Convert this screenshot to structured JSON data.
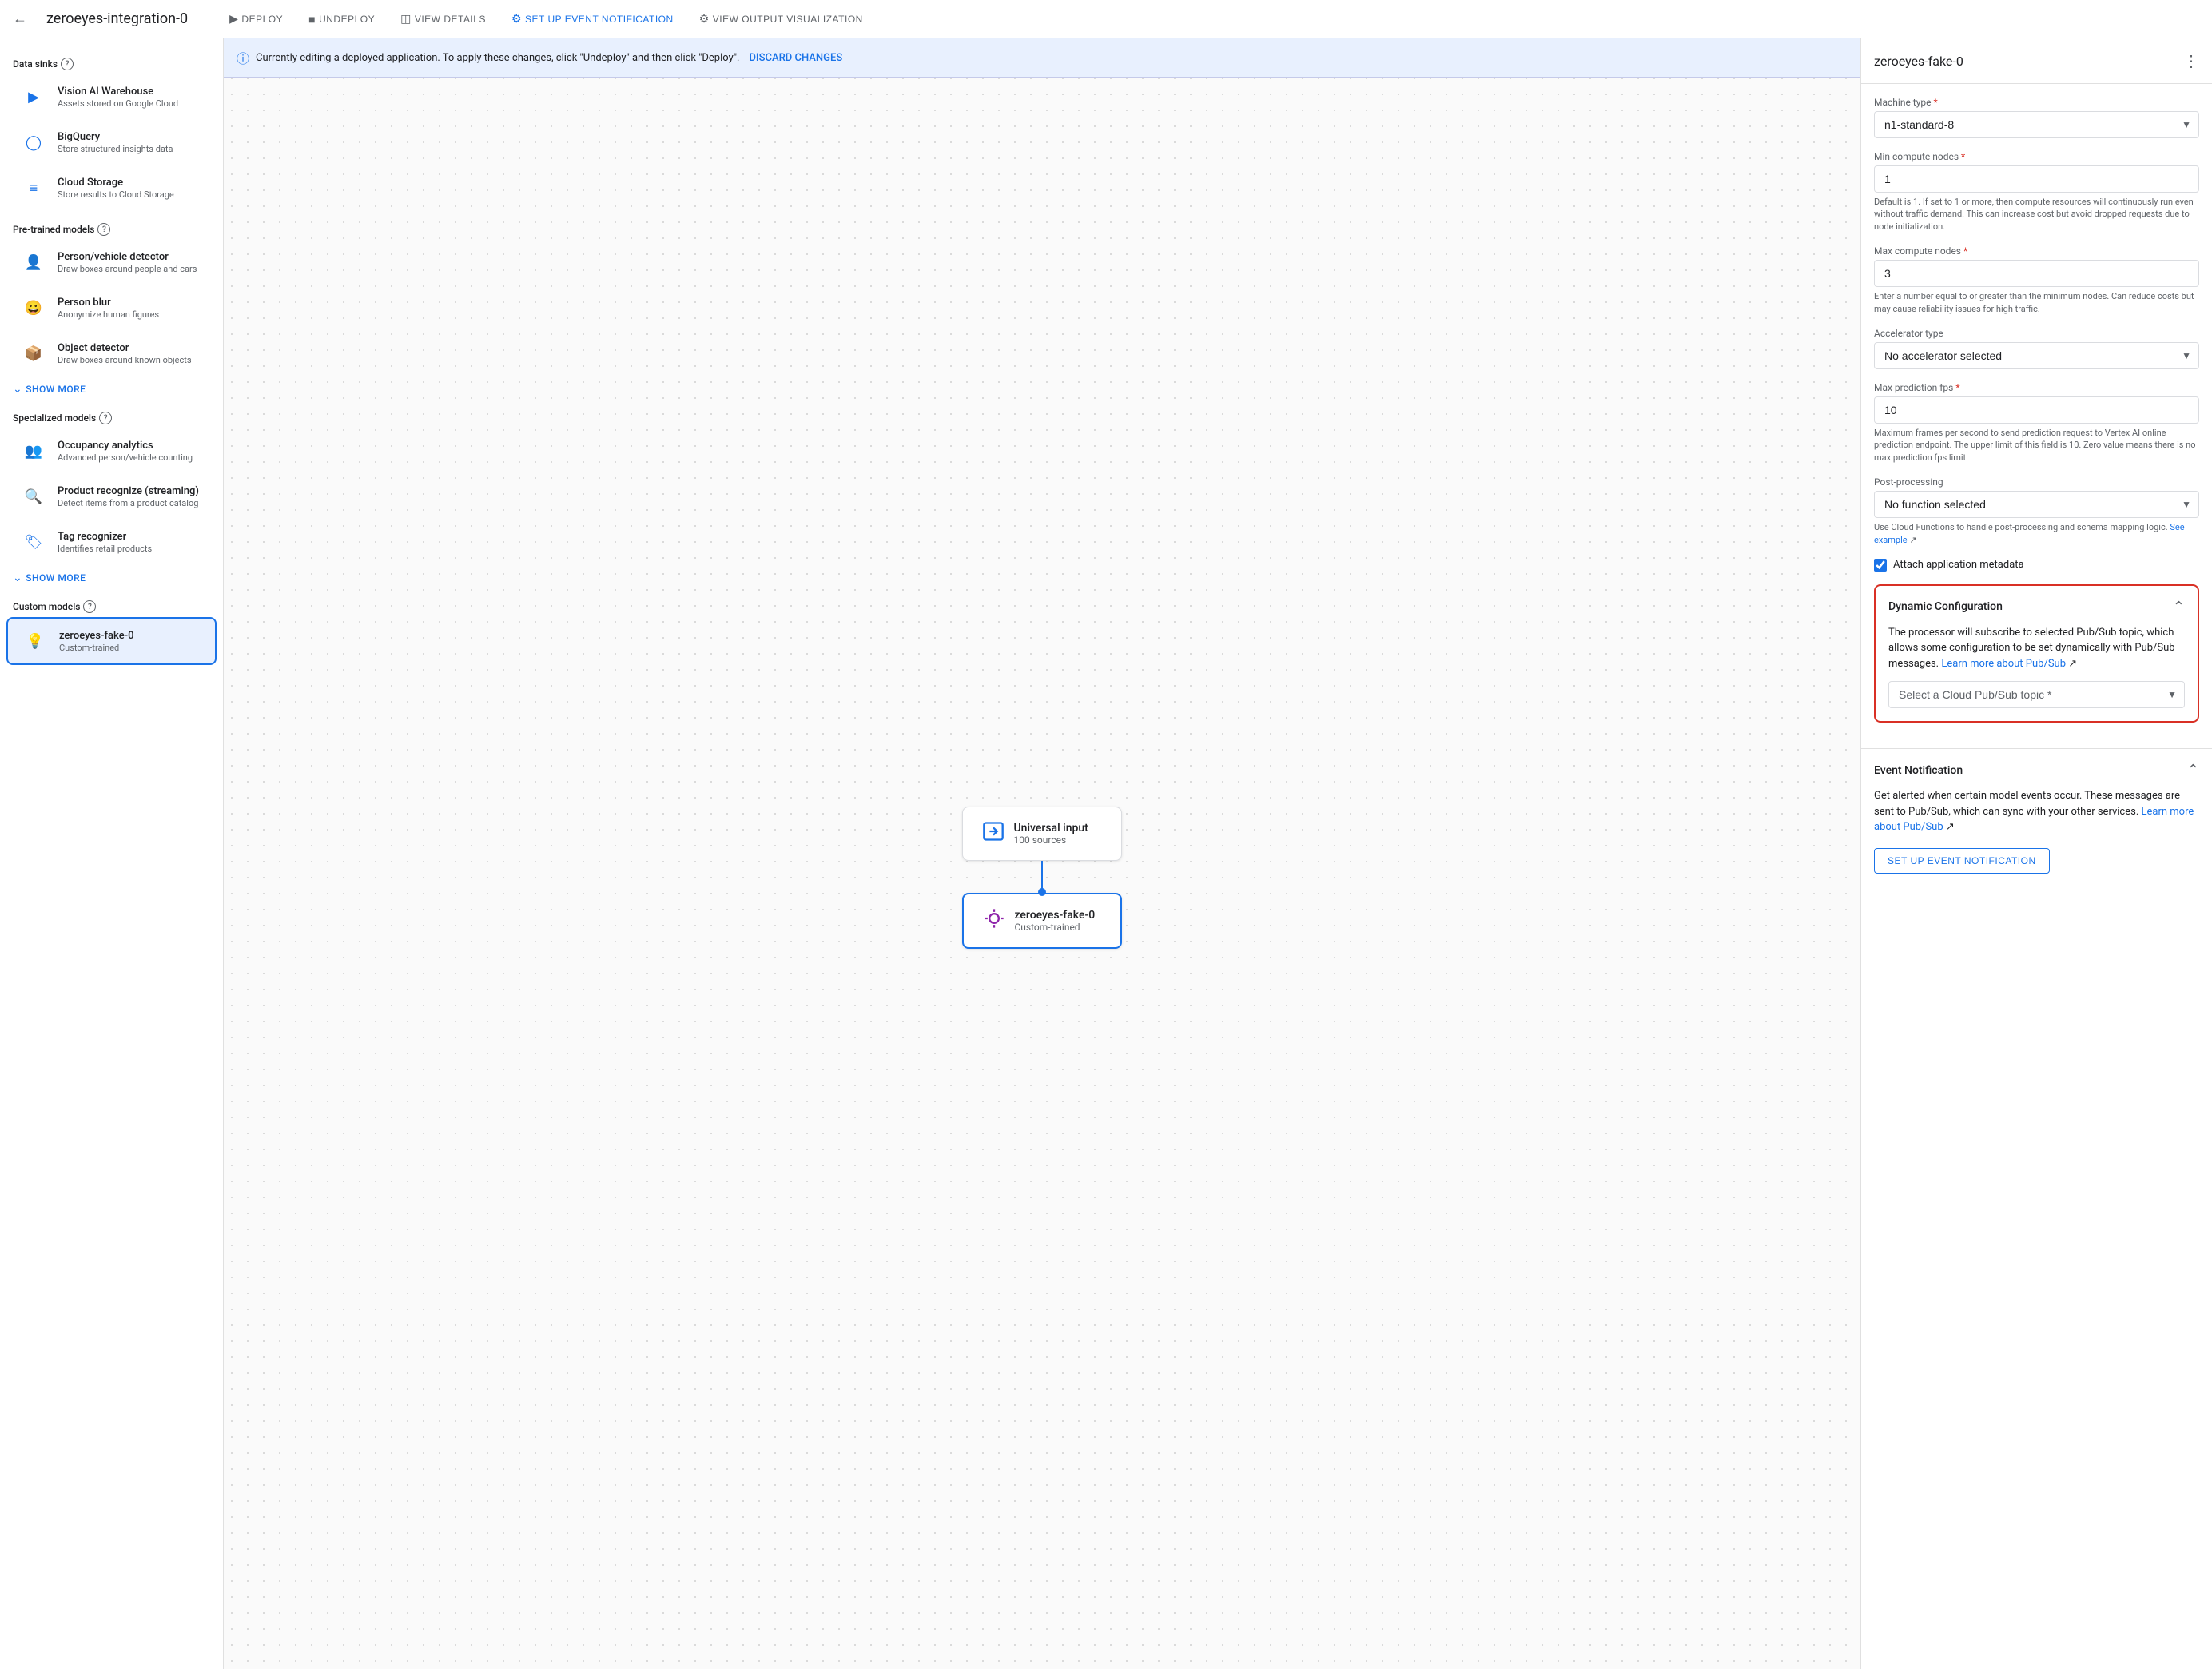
{
  "header": {
    "app_title": "zeroeyes-integration-0",
    "nav_items": [
      {
        "label": "DEPLOY",
        "icon": "▶",
        "active": false
      },
      {
        "label": "UNDEPLOY",
        "icon": "■",
        "active": false
      },
      {
        "label": "VIEW DETAILS",
        "icon": "⊞",
        "active": false
      },
      {
        "label": "SET UP EVENT NOTIFICATION",
        "icon": "⚙",
        "active": true
      },
      {
        "label": "VIEW OUTPUT VISUALIZATION",
        "icon": "⚙",
        "active": false
      }
    ]
  },
  "sidebar": {
    "data_sinks_title": "Data sinks",
    "pre_trained_title": "Pre-trained models",
    "specialized_title": "Specialized models",
    "custom_title": "Custom models",
    "show_more_label": "SHOW MORE",
    "data_sinks": [
      {
        "title": "Vision AI Warehouse",
        "desc": "Assets stored on Google Cloud",
        "icon": "▶",
        "color": "blue"
      },
      {
        "title": "BigQuery",
        "desc": "Store structured insights data",
        "icon": "◎",
        "color": "blue"
      },
      {
        "title": "Cloud Storage",
        "desc": "Store results to Cloud Storage",
        "icon": "≡",
        "color": "blue"
      }
    ],
    "pre_trained": [
      {
        "title": "Person/vehicle detector",
        "desc": "Draw boxes around people and cars",
        "icon": "👤",
        "color": "teal"
      },
      {
        "title": "Person blur",
        "desc": "Anonymize human figures",
        "icon": "😊",
        "color": "teal"
      },
      {
        "title": "Object detector",
        "desc": "Draw boxes around known objects",
        "icon": "📦",
        "color": "teal"
      }
    ],
    "specialized": [
      {
        "title": "Occupancy analytics",
        "desc": "Advanced person/vehicle counting",
        "icon": "👥",
        "color": "teal"
      },
      {
        "title": "Product recognize (streaming)",
        "desc": "Detect items from a product catalog",
        "icon": "🔍",
        "color": "teal"
      },
      {
        "title": "Tag recognizer",
        "desc": "Identifies retail products",
        "icon": "🏷",
        "color": "teal"
      }
    ],
    "custom": [
      {
        "title": "zeroeyes-fake-0",
        "desc": "Custom-trained",
        "icon": "💡",
        "color": "purple",
        "selected": true
      }
    ]
  },
  "canvas": {
    "banner_text": "Currently editing a deployed application. To apply these changes, click \"Undeploy\" and then click \"Deploy\".",
    "discard_label": "DISCARD CHANGES",
    "universal_input_title": "Universal input",
    "universal_input_subtitle": "100 sources",
    "node_title": "zeroeyes-fake-0",
    "node_subtitle": "Custom-trained"
  },
  "right_panel": {
    "title": "zeroeyes-fake-0",
    "machine_type_label": "Machine type",
    "machine_type_required": "*",
    "machine_type_value": "n1-standard-8",
    "min_compute_label": "Min compute nodes",
    "min_compute_required": "*",
    "min_compute_value": "1",
    "min_compute_hint": "Default is 1. If set to 1 or more, then compute resources will continuously run even without traffic demand. This can increase cost but avoid dropped requests due to node initialization.",
    "max_compute_label": "Max compute nodes",
    "max_compute_required": "*",
    "max_compute_value": "3",
    "max_compute_hint": "Enter a number equal to or greater than the minimum nodes. Can reduce costs but may cause reliability issues for high traffic.",
    "accelerator_label": "Accelerator type",
    "accelerator_value": "No accelerator selected",
    "max_fps_label": "Max prediction fps",
    "max_fps_required": "*",
    "max_fps_value": "10",
    "max_fps_hint": "Maximum frames per second to send prediction request to Vertex AI online prediction endpoint. The upper limit of this field is 10. Zero value means there is no max prediction fps limit.",
    "post_processing_label": "Post-processing",
    "post_processing_value": "No function selected",
    "post_processing_hint": "Use Cloud Functions to handle post-processing and schema mapping logic.",
    "see_example_label": "See example",
    "attach_metadata_label": "Attach application metadata",
    "dynamic_config_title": "Dynamic Configuration",
    "dynamic_config_desc": "The processor will subscribe to selected Pub/Sub topic, which allows some configuration to be set dynamically with Pub/Sub messages.",
    "learn_pubsub_label": "Learn more about Pub/Sub",
    "pubsub_placeholder": "Select a Cloud Pub/Sub topic",
    "pubsub_required": "*",
    "event_notification_title": "Event Notification",
    "event_desc": "Get alerted when certain model events occur. These messages are sent to Pub/Sub, which can sync with your other services.",
    "learn_event_label": "Learn more about Pub/Sub",
    "setup_event_label": "SET UP EVENT NOTIFICATION"
  }
}
